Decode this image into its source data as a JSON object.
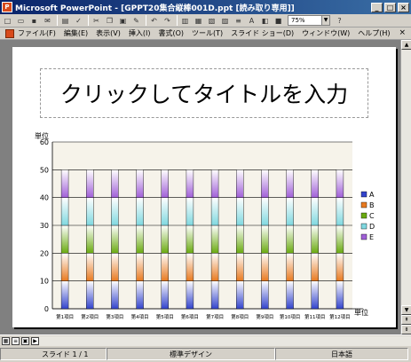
{
  "window": {
    "title": "Microsoft PowerPoint - [GPPT20集合縦棒001D.ppt [読み取り専用]]",
    "minimize": "_",
    "maximize": "□",
    "close": "×"
  },
  "toolbar": {
    "zoom": "75%",
    "help": "?"
  },
  "menu": {
    "items": [
      "ファイル(F)",
      "編集(E)",
      "表示(V)",
      "挿入(I)",
      "書式(O)",
      "ツール(T)",
      "スライド ショー(D)",
      "ウィンドウ(W)",
      "ヘルプ(H)"
    ],
    "close": "×"
  },
  "slide": {
    "title_placeholder": "クリックしてタイトルを入力"
  },
  "chart_data": {
    "type": "bar",
    "stacked": true,
    "title": "",
    "ylabel": "単位",
    "xlabel": "単位",
    "ylim": [
      0,
      60
    ],
    "yticks": [
      0,
      10,
      20,
      30,
      40,
      50,
      60
    ],
    "grid": true,
    "legend_position": "right",
    "categories": [
      "第1項目",
      "第2項目",
      "第3項目",
      "第4項目",
      "第5項目",
      "第6項目",
      "第7項目",
      "第8項目",
      "第9項目",
      "第10項目",
      "第11項目",
      "第12項目"
    ],
    "series": [
      {
        "name": "A",
        "color": "#3344cc",
        "values": [
          10,
          10,
          10,
          10,
          10,
          10,
          10,
          10,
          10,
          10,
          10,
          10
        ]
      },
      {
        "name": "B",
        "color": "#e87a20",
        "values": [
          10,
          10,
          10,
          10,
          10,
          10,
          10,
          10,
          10,
          10,
          10,
          10
        ]
      },
      {
        "name": "C",
        "color": "#6aaa10",
        "values": [
          10,
          10,
          10,
          10,
          10,
          10,
          10,
          10,
          10,
          10,
          10,
          10
        ]
      },
      {
        "name": "D",
        "color": "#80d8e0",
        "values": [
          10,
          10,
          10,
          10,
          10,
          10,
          10,
          10,
          10,
          10,
          10,
          10
        ]
      },
      {
        "name": "E",
        "color": "#a060d8",
        "values": [
          10,
          10,
          10,
          10,
          10,
          10,
          10,
          10,
          10,
          10,
          10,
          10
        ]
      }
    ]
  },
  "status": {
    "slide": "スライド 1 / 1",
    "design": "標準デザイン",
    "language": "日本語"
  }
}
